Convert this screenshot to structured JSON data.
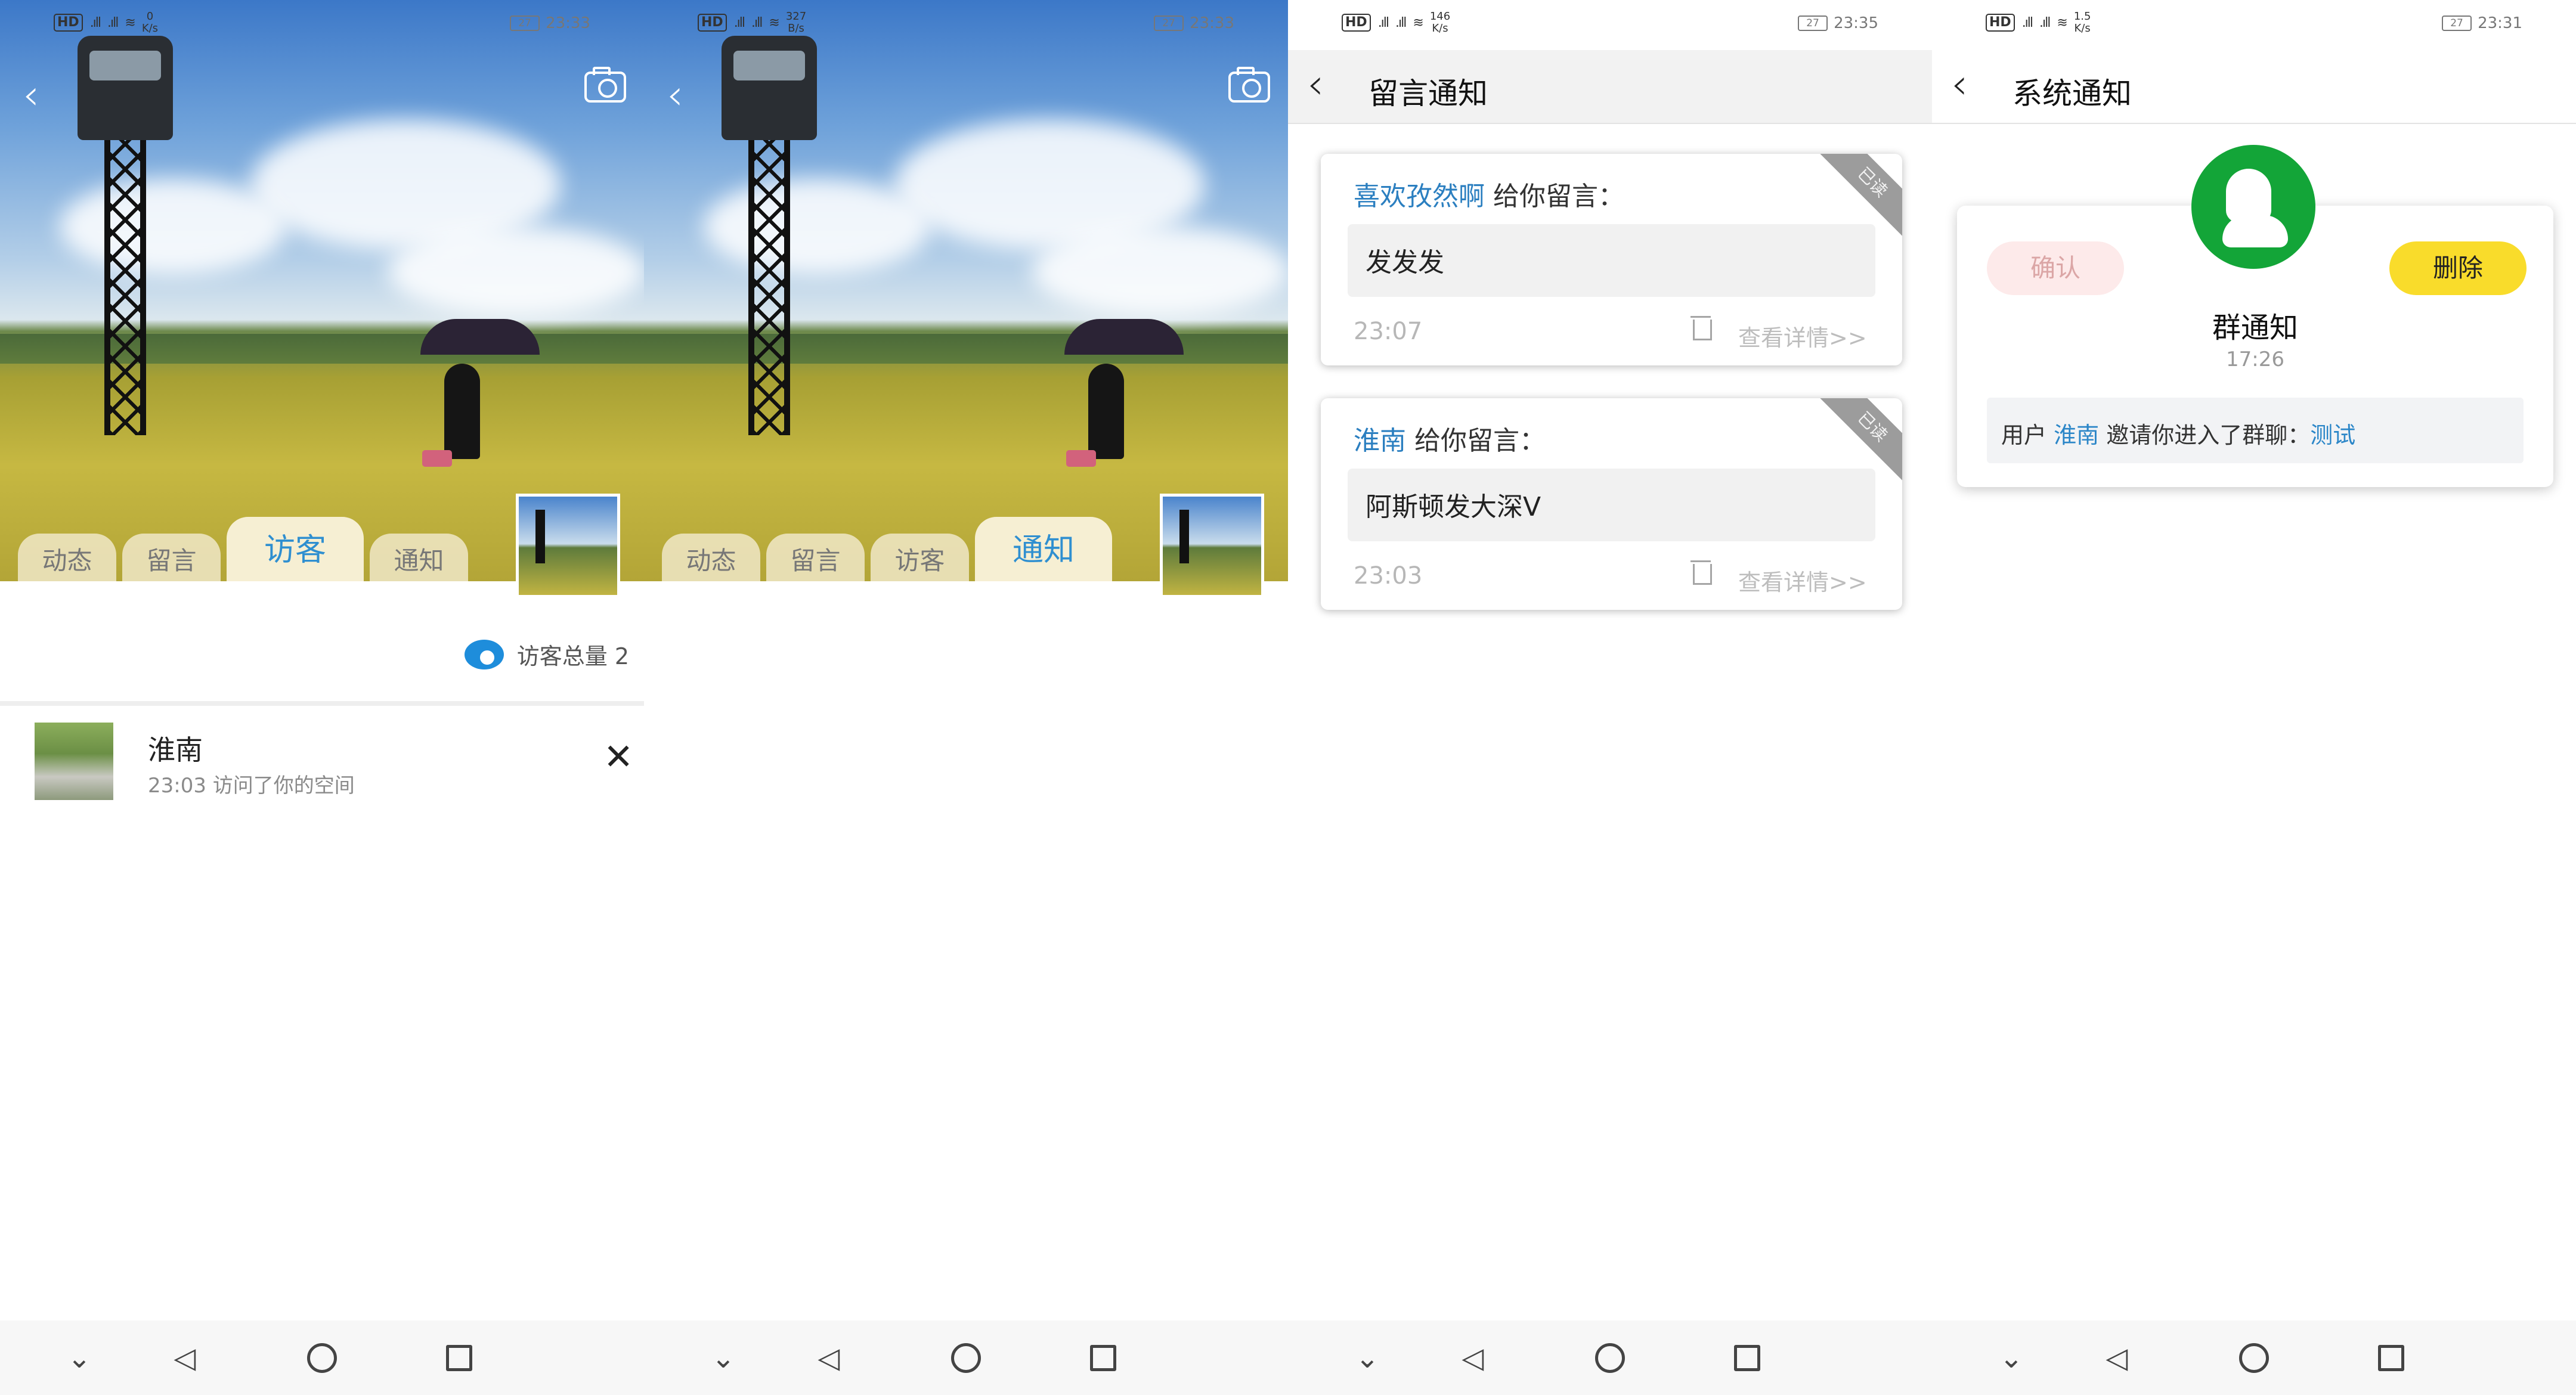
{
  "screens": [
    {
      "status": {
        "hd": "HD",
        "net": "26",
        "net2": "46",
        "speed_val": "0",
        "speed_unit": "K/s",
        "battery": "27",
        "time": "23:33"
      },
      "tabs": [
        "动态",
        "留言",
        "访客",
        "通知"
      ],
      "active_tab": "访客",
      "visitors": {
        "total_label": "访客总量 2",
        "items": [
          {
            "name": "淮南",
            "desc": "23:03 访问了你的空间"
          }
        ]
      }
    },
    {
      "status": {
        "hd": "HD",
        "net": "26",
        "net2": "46",
        "speed_val": "327",
        "speed_unit": "B/s",
        "battery": "27",
        "time": "23:33"
      },
      "tabs": [
        "动态",
        "留言",
        "访客",
        "通知"
      ],
      "active_tab": "通知"
    },
    {
      "status": {
        "hd": "HD",
        "net": "26",
        "net2": "46",
        "speed_val": "146",
        "speed_unit": "K/s",
        "battery": "27",
        "time": "23:35"
      },
      "title": "留言通知",
      "messages": [
        {
          "name": "喜欢孜然啊",
          "suffix": " 给你留言：",
          "content": "发发发",
          "time": "23:07",
          "badge": "已读",
          "detail": "查看详情>>"
        },
        {
          "name": "淮南",
          "suffix": " 给你留言：",
          "content": "阿斯顿发大深V",
          "time": "23:03",
          "badge": "已读",
          "detail": "查看详情>>"
        }
      ]
    },
    {
      "status": {
        "hd": "HD",
        "net": "26",
        "net2": "46",
        "speed_val": "1.5",
        "speed_unit": "K/s",
        "battery": "27",
        "time": "23:31"
      },
      "title": "系统通知",
      "notice": {
        "confirm": "确认",
        "delete": "删除",
        "title": "群通知",
        "time": "17:26",
        "prefix": "用户 ",
        "user": "淮南",
        "middle": " 邀请你进入了群聊：",
        "group": "测试"
      }
    }
  ],
  "icons": [
    "back-chevron-icon",
    "camera-icon",
    "eye-icon",
    "close-icon",
    "trash-icon",
    "group-icon",
    "nav-down-icon",
    "nav-back-icon",
    "nav-home-icon",
    "nav-recent-icon"
  ],
  "colors": {
    "accent_blue": "#2f8fd0",
    "group_green": "#13a538",
    "delete_yellow": "#f9dc2b"
  }
}
